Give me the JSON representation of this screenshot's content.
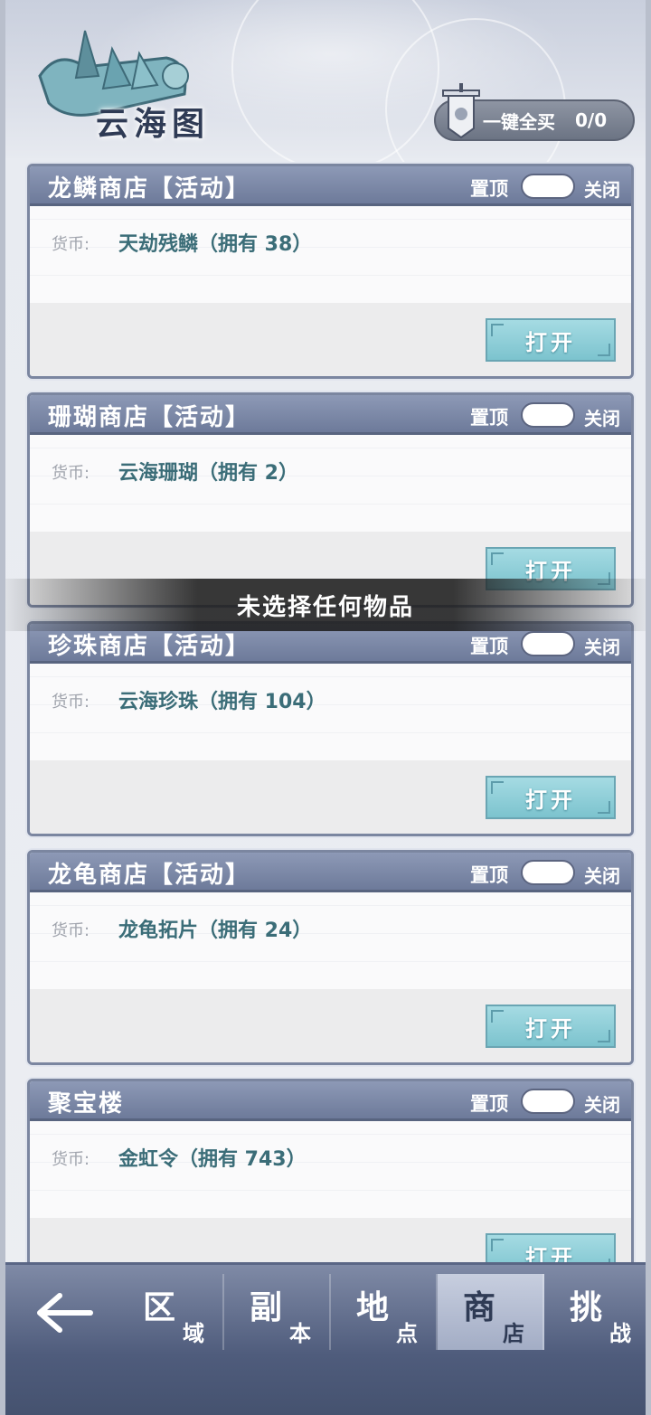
{
  "header": {
    "title": "云海图",
    "buy_all_label": "一键全买",
    "buy_all_count": "0/0"
  },
  "shops": [
    {
      "name": "龙鳞商店【活动】",
      "pin_label": "置顶",
      "toggle_state": "关闭",
      "currency_label": "货币:",
      "currency_value": "天劫残鳞（拥有 38）",
      "open_label": "打开"
    },
    {
      "name": "珊瑚商店【活动】",
      "pin_label": "置顶",
      "toggle_state": "关闭",
      "currency_label": "货币:",
      "currency_value": "云海珊瑚（拥有 2）",
      "open_label": "打开"
    },
    {
      "name": "珍珠商店【活动】",
      "pin_label": "置顶",
      "toggle_state": "关闭",
      "currency_label": "货币:",
      "currency_value": "云海珍珠（拥有 104）",
      "open_label": "打开"
    },
    {
      "name": "龙龟商店【活动】",
      "pin_label": "置顶",
      "toggle_state": "关闭",
      "currency_label": "货币:",
      "currency_value": "龙龟拓片（拥有 24）",
      "open_label": "打开"
    },
    {
      "name": "聚宝楼",
      "pin_label": "置顶",
      "toggle_state": "关闭",
      "currency_label": "货币:",
      "currency_value": "金虹令（拥有 743）",
      "open_label": "打开"
    }
  ],
  "toast": {
    "message": "未选择任何物品"
  },
  "bottom_nav": {
    "tabs": [
      {
        "big": "区",
        "small": "域"
      },
      {
        "big": "副",
        "small": "本"
      },
      {
        "big": "地",
        "small": "点"
      },
      {
        "big": "商",
        "small": "店"
      },
      {
        "big": "挑",
        "small": "战"
      }
    ],
    "active_tab": "商店"
  },
  "colors": {
    "card_header": "#7a86a4",
    "currency_text": "#3b6d78",
    "open_button": "#8ccbd5",
    "nav_bg": "#55617f",
    "toast_bg": "#1e1e1e"
  }
}
